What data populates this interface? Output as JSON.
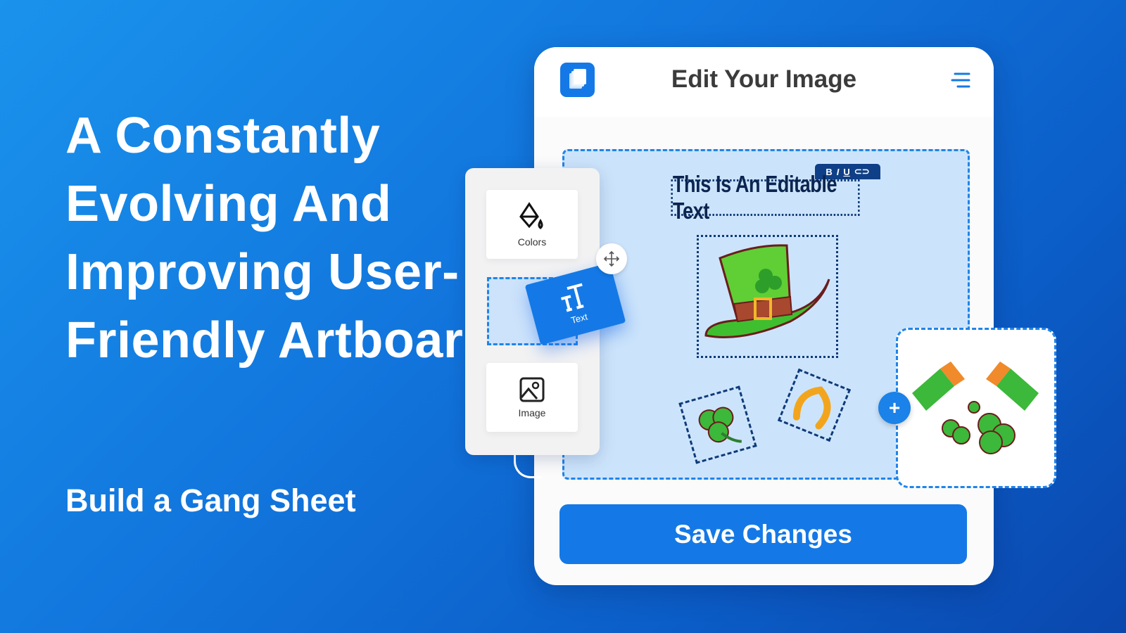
{
  "hero": {
    "headline": "A Constantly Evolving And Improving User-Friendly Artboard",
    "subtitle": "Build a Gang Sheet"
  },
  "editor": {
    "title": "Edit Your Image",
    "logo_icon": "layers-icon",
    "menu_icon": "menu-icon",
    "editable_text": "This Is An Editable Text",
    "text_toolbar": {
      "bold": "B",
      "italic": "I",
      "underline": "U",
      "link_icon": "link-icon"
    },
    "tools": [
      {
        "label": "Colors",
        "icon": "paint-bucket-icon"
      },
      {
        "label": "Text",
        "icon": "text-size-icon"
      },
      {
        "label": "Image",
        "icon": "image-icon"
      }
    ],
    "add_label": "+",
    "save_label": "Save Changes"
  },
  "colors": {
    "accent": "#1479e6",
    "artboard": "#cce4fb",
    "selection": "#0f3a7a"
  }
}
